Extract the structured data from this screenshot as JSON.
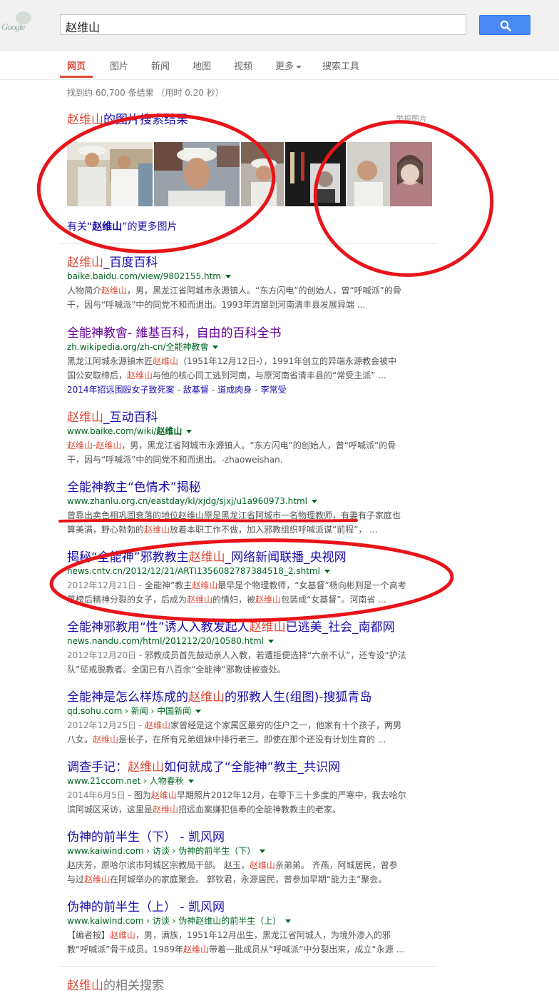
{
  "header": {
    "logo_text": "Google",
    "query": "赵维山",
    "search_icon": "magnifier-icon"
  },
  "nav": {
    "tabs": [
      "网页",
      "图片",
      "新闻",
      "地图",
      "视频",
      "更多",
      "搜索工具"
    ],
    "active": "网页"
  },
  "stats": "找到约 60,700 条结果 （用时 0.20 秒）",
  "image_block": {
    "title_query": "赵维山",
    "title_rest": "的图片搜索结果",
    "report_label": "举报图片",
    "more_prefix": "有关“",
    "more_query": "赵维山",
    "more_suffix": "”的更多图片"
  },
  "results": [
    {
      "title": [
        {
          "t": "赵维山",
          "hl": true
        },
        {
          "t": "_百度百科"
        }
      ],
      "url": [
        {
          "t": "baike.baidu.com/view/9802155.htm"
        }
      ],
      "snippet": [
        [
          {
            "t": "人物简介"
          },
          {
            "t": "赵维山",
            "hl": true
          },
          {
            "t": "，男，黑龙江省阿城市永源镇人。“东方闪电”的创始人，曾“呼喊派”的骨"
          }
        ],
        [
          {
            "t": "干，因与“呼喊派”中的同党不和而退出。1993年流窜到河南清丰县发展异端 ..."
          }
        ]
      ]
    },
    {
      "title": [
        {
          "t": "全能神教會- 維基百科，自由的百科全书"
        }
      ],
      "visited": true,
      "url": [
        {
          "t": "zh.wikipedia.org/zh-cn/全能神教會"
        }
      ],
      "snippet": [
        [
          {
            "t": "黑龙江阿城永源镇木匠"
          },
          {
            "t": "赵维山",
            "hl": true
          },
          {
            "t": "（1951年12月12日-），1991年创立的异端永源教会被中"
          }
        ],
        [
          {
            "t": "国公安取缔后，"
          },
          {
            "t": "赵维山",
            "hl": true
          },
          {
            "t": "与他的核心同工逃到河南，与原河南省清丰县的“常受主派” ..."
          }
        ]
      ],
      "sitelinks": [
        "2014年招远围殴女子致死案",
        "敌基督",
        "道成肉身",
        "李常受"
      ]
    },
    {
      "title": [
        {
          "t": "赵维山",
          "hl": true
        },
        {
          "t": "_互动百科"
        }
      ],
      "url": [
        {
          "t": "www.baike.com/wiki/"
        },
        {
          "t": "赵维山",
          "b": true
        }
      ],
      "snippet": [
        [
          {
            "t": "赵维山",
            "hl": true
          },
          {
            "t": "-"
          },
          {
            "t": "赵维山",
            "hl": true
          },
          {
            "t": "，男，黑龙江省阿城市永源镇人。“东方闪电”的创始人，曾“呼喊派”的骨"
          }
        ],
        [
          {
            "t": "干，因与“呼喊派”中的同党不和而退出。-zhaoweishan."
          }
        ]
      ]
    },
    {
      "title": [
        {
          "t": "全能神教主“色情术”揭秘"
        }
      ],
      "url": [
        {
          "t": "www.zhanlu.org.cn/eastday/kl/xjdg/sjxj/u1a960973.html"
        }
      ],
      "snippet": [
        [
          {
            "t": "曾靠出卖色相巩固衰落的地位赵维山原是黑龙江省阿城市一名物理教师，有妻有子家庭也"
          }
        ],
        [
          {
            "t": "算美满，野心勃勃的"
          },
          {
            "t": "赵维山",
            "hl": true
          },
          {
            "t": "放着本职工作不做，加入邪教组织呼喊派谋“前程”， ..."
          }
        ]
      ]
    },
    {
      "title": [
        {
          "t": "揭秘“全能神”邪教教主"
        },
        {
          "t": "赵维山",
          "hl": true
        },
        {
          "t": "_网络新闻联播_央视网"
        }
      ],
      "url": [
        {
          "t": "news.cntv.cn/2012/12/21/ARTI1356082787384518_2.shtml"
        }
      ],
      "snippet": [
        [
          {
            "t": "2012年12月21日 - ",
            "date": true
          },
          {
            "t": "全能神”教主"
          },
          {
            "t": "赵维山",
            "hl": true
          },
          {
            "t": "最早是个物理教师，“女基督”杨向彬则是一个高考"
          }
        ],
        [
          {
            "t": "落榜后精神分裂的女子，后成为"
          },
          {
            "t": "赵维山",
            "hl": true
          },
          {
            "t": "的情妇，被"
          },
          {
            "t": "赵维山",
            "hl": true
          },
          {
            "t": "包装成“女基督”。河南省 ..."
          }
        ]
      ]
    },
    {
      "title": [
        {
          "t": "全能神邪教用“性”诱人入教发起人"
        },
        {
          "t": "赵维山",
          "hl": true
        },
        {
          "t": "已逃美_社会_南都网"
        }
      ],
      "url": [
        {
          "t": "news.nandu.com/html/201212/20/10580.html"
        }
      ],
      "snippet": [
        [
          {
            "t": "2012年12月20日 - ",
            "date": true
          },
          {
            "t": "邪教成员首先鼓动亲人入教，若遭拒便选择“六亲不认”，还专设“护法"
          }
        ],
        [
          {
            "t": "队”惩戒脱教者。全国已有八百余“全能神”邪教徒被查处。"
          }
        ]
      ]
    },
    {
      "title": [
        {
          "t": "全能神是怎么样炼成的"
        },
        {
          "t": "赵维山",
          "hl": true
        },
        {
          "t": "的邪教人生(组图)-搜狐青岛"
        }
      ],
      "url": [
        {
          "t": "qd.sohu.com › 新闻 › 中国新闻"
        }
      ],
      "snippet": [
        [
          {
            "t": "2012年12月25日 - ",
            "date": true
          },
          {
            "t": "赵维山",
            "hl": true
          },
          {
            "t": "家曾经是这个家属区最穷的住户之一，他家有十个孩子，两男"
          }
        ],
        [
          {
            "t": "八女。"
          },
          {
            "t": "赵维山",
            "hl": true
          },
          {
            "t": "是长子，在所有兄弟姐妹中排行老三。即使在那个还没有计划生育的 ..."
          }
        ]
      ]
    },
    {
      "title": [
        {
          "t": "调查手记："
        },
        {
          "t": "赵维山",
          "hl": true
        },
        {
          "t": "如何就成了“全能神”教主_共识网"
        }
      ],
      "url": [
        {
          "t": "www.21ccom.net › 人物春秋"
        }
      ],
      "snippet": [
        [
          {
            "t": "2014年6月5日 - ",
            "date": true
          },
          {
            "t": "图为"
          },
          {
            "t": "赵维山",
            "hl": true
          },
          {
            "t": "早期照片2012年12月，在零下三十多度的严寒中，我去哈尔"
          }
        ],
        [
          {
            "t": "滨阿城区采访，这里是"
          },
          {
            "t": "赵维山",
            "hl": true
          },
          {
            "t": "招远血案嫌犯信奉的全能神教教主的老家。"
          }
        ]
      ]
    },
    {
      "title": [
        {
          "t": "伪神的前半生（下） - 凯风网"
        }
      ],
      "url": [
        {
          "t": "www.kaiwind.com › 访谈 › 伪神的前半生（下）"
        }
      ],
      "snippet": [
        [
          {
            "t": "赵庆芳，原哈尔滨市阿城区宗教局干部。 赵玉，"
          },
          {
            "t": "赵维山",
            "hl": true
          },
          {
            "t": "亲弟弟。 齐燕，阿城居民，曾参"
          }
        ],
        [
          {
            "t": "与过"
          },
          {
            "t": "赵维山",
            "hl": true
          },
          {
            "t": "在阿城举办的家庭聚会。 郭钦君，永源居民，曾参加早期“能力主”聚会。"
          }
        ]
      ]
    },
    {
      "title": [
        {
          "t": "伪神的前半生（上） - 凯风网"
        }
      ],
      "url": [
        {
          "t": "www.kaiwind.com › 访谈 › 伪神赵维山的前半生（上）"
        }
      ],
      "snippet": [
        [
          {
            "t": "【编者按】"
          },
          {
            "t": "赵维山",
            "hl": true
          },
          {
            "t": "，男，满族，1951年12月出生，黑龙江省阿城人，为境外渗入的邪"
          }
        ],
        [
          {
            "t": "教“呼喊派”骨干成员。1989年"
          },
          {
            "t": "赵维山",
            "hl": true
          },
          {
            "t": "带着一批成员从“呼喊派”中分裂出来，成立“永源 ..."
          }
        ]
      ]
    }
  ],
  "related": {
    "query": "赵维山",
    "rest": "的相关搜索"
  },
  "colors": {
    "link": "#1a0dab",
    "visited": "#609",
    "url": "#006621",
    "highlight": "#dd4b39",
    "annotation": "#e8141a"
  }
}
